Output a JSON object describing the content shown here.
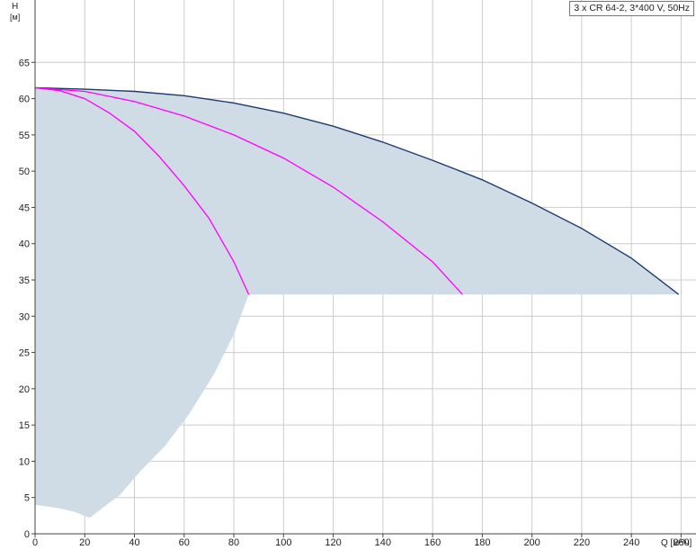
{
  "chart_data": {
    "type": "line",
    "title": "3 x CR 64-2, 3*400 V, 50Hz",
    "ylabel": "H",
    "yunit": "[м]",
    "xlabel": "Q [м³/ч]",
    "xlim": [
      0,
      266
    ],
    "ylim": [
      0,
      70
    ],
    "x_ticks": [
      0,
      20,
      40,
      60,
      80,
      100,
      120,
      140,
      160,
      180,
      200,
      220,
      240,
      260
    ],
    "y_ticks": [
      0,
      5,
      10,
      15,
      20,
      25,
      30,
      35,
      40,
      45,
      50,
      55,
      60,
      65
    ],
    "grid": true,
    "colors": {
      "area": "#cfdce6",
      "system_curve": "#1f3a6e",
      "pump_curves": "#ff00ff",
      "grid": "#cccccc",
      "axis": "#444444"
    },
    "operating_area": [
      [
        0,
        4
      ],
      [
        10,
        3.5
      ],
      [
        16,
        3
      ],
      [
        22,
        2.2
      ],
      [
        28,
        3.8
      ],
      [
        34,
        5.3
      ],
      [
        42,
        8.5
      ],
      [
        52,
        12
      ],
      [
        62,
        16.5
      ],
      [
        72,
        22
      ],
      [
        80,
        27.5
      ],
      [
        86,
        33
      ],
      [
        259,
        33
      ],
      [
        240,
        38
      ],
      [
        220,
        42.1
      ],
      [
        200,
        45.6
      ],
      [
        180,
        48.8
      ],
      [
        160,
        51.5
      ],
      [
        140,
        54
      ],
      [
        120,
        56.2
      ],
      [
        100,
        58
      ],
      [
        80,
        59.4
      ],
      [
        60,
        60.4
      ],
      [
        40,
        61
      ],
      [
        20,
        61.3
      ],
      [
        0,
        61.5
      ]
    ],
    "series": [
      {
        "x": [
          0,
          20,
          40,
          60,
          80,
          100,
          120,
          140,
          160,
          180,
          200,
          220,
          240,
          259
        ],
        "y": [
          61.5,
          61.3,
          61,
          60.4,
          59.4,
          58,
          56.2,
          54,
          51.5,
          48.8,
          45.6,
          42.1,
          38,
          33
        ]
      },
      {
        "x": [
          0,
          10,
          20,
          30,
          40,
          50,
          60,
          70,
          80,
          86
        ],
        "y": [
          61.5,
          61.1,
          60,
          58,
          55.5,
          52,
          48,
          43.5,
          37.5,
          33
        ]
      },
      {
        "x": [
          0,
          20,
          40,
          60,
          80,
          100,
          120,
          140,
          160,
          172
        ],
        "y": [
          61.5,
          61,
          59.6,
          57.6,
          55,
          51.8,
          47.8,
          43,
          37.5,
          33
        ]
      }
    ]
  }
}
